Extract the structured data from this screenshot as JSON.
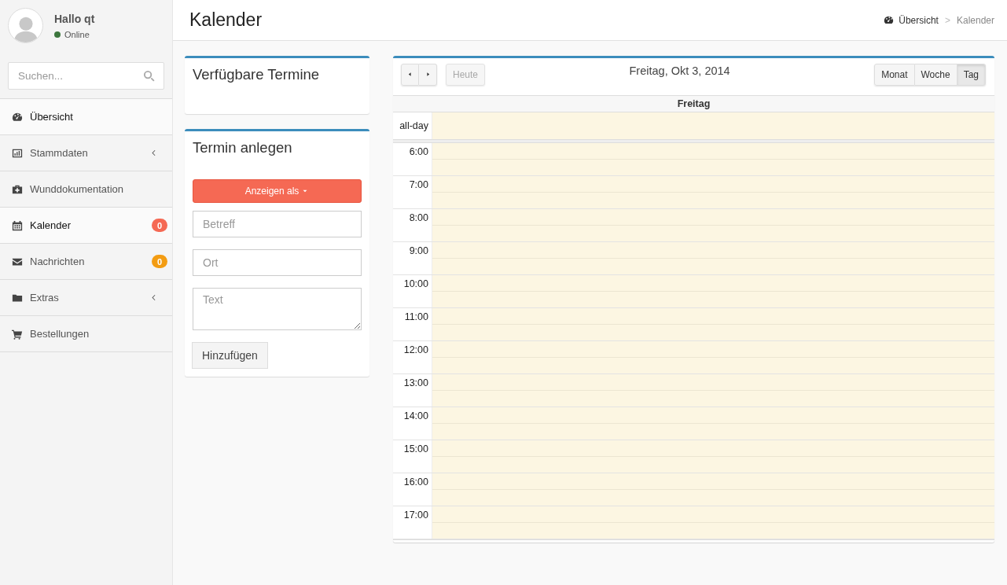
{
  "user": {
    "greeting": "Hallo qt",
    "status": "Online",
    "online": true
  },
  "search": {
    "placeholder": "Suchen..."
  },
  "menu": [
    {
      "label": "Übersicht",
      "selected": true,
      "expandable": false
    },
    {
      "label": "Stammdaten",
      "selected": false,
      "expandable": true
    },
    {
      "label": "Wunddokumentation",
      "selected": false,
      "expandable": false
    },
    {
      "label": "Kalender",
      "selected": true,
      "expandable": false,
      "badge": {
        "text": "0",
        "color": "#f56954"
      }
    },
    {
      "label": "Nachrichten",
      "selected": false,
      "expandable": false,
      "badge": {
        "text": "0",
        "color": "#f39c12"
      }
    },
    {
      "label": "Extras",
      "selected": false,
      "expandable": true
    },
    {
      "label": "Bestellungen",
      "selected": false,
      "expandable": false
    }
  ],
  "header": {
    "title": "Kalender",
    "breadcrumb": [
      {
        "label": "Übersicht"
      },
      {
        "label": "Kalender"
      }
    ],
    "separator": ">"
  },
  "available": {
    "title": "Verfügbare Termine"
  },
  "create": {
    "title": "Termin anlegen",
    "dropdown": "Anzeigen als",
    "fields": [
      {
        "kind": "input",
        "placeholder": "Betreff"
      },
      {
        "kind": "input",
        "placeholder": "Ort"
      },
      {
        "kind": "textarea",
        "placeholder": "Text"
      }
    ],
    "submit": "Hinzufügen"
  },
  "calendar": {
    "title": "Freitag, Okt 3, 2014",
    "today": {
      "label": "Heute",
      "disabled": true
    },
    "views": [
      {
        "label": "Monat",
        "selected": false
      },
      {
        "label": "Woche",
        "selected": false
      },
      {
        "label": "Tag",
        "selected": true
      }
    ],
    "day_header": "Freitag",
    "allday_label": "all-day",
    "hours": [
      "6:00",
      "7:00",
      "8:00",
      "9:00",
      "10:00",
      "11:00",
      "12:00",
      "13:00",
      "14:00",
      "15:00",
      "16:00",
      "17:00"
    ]
  }
}
